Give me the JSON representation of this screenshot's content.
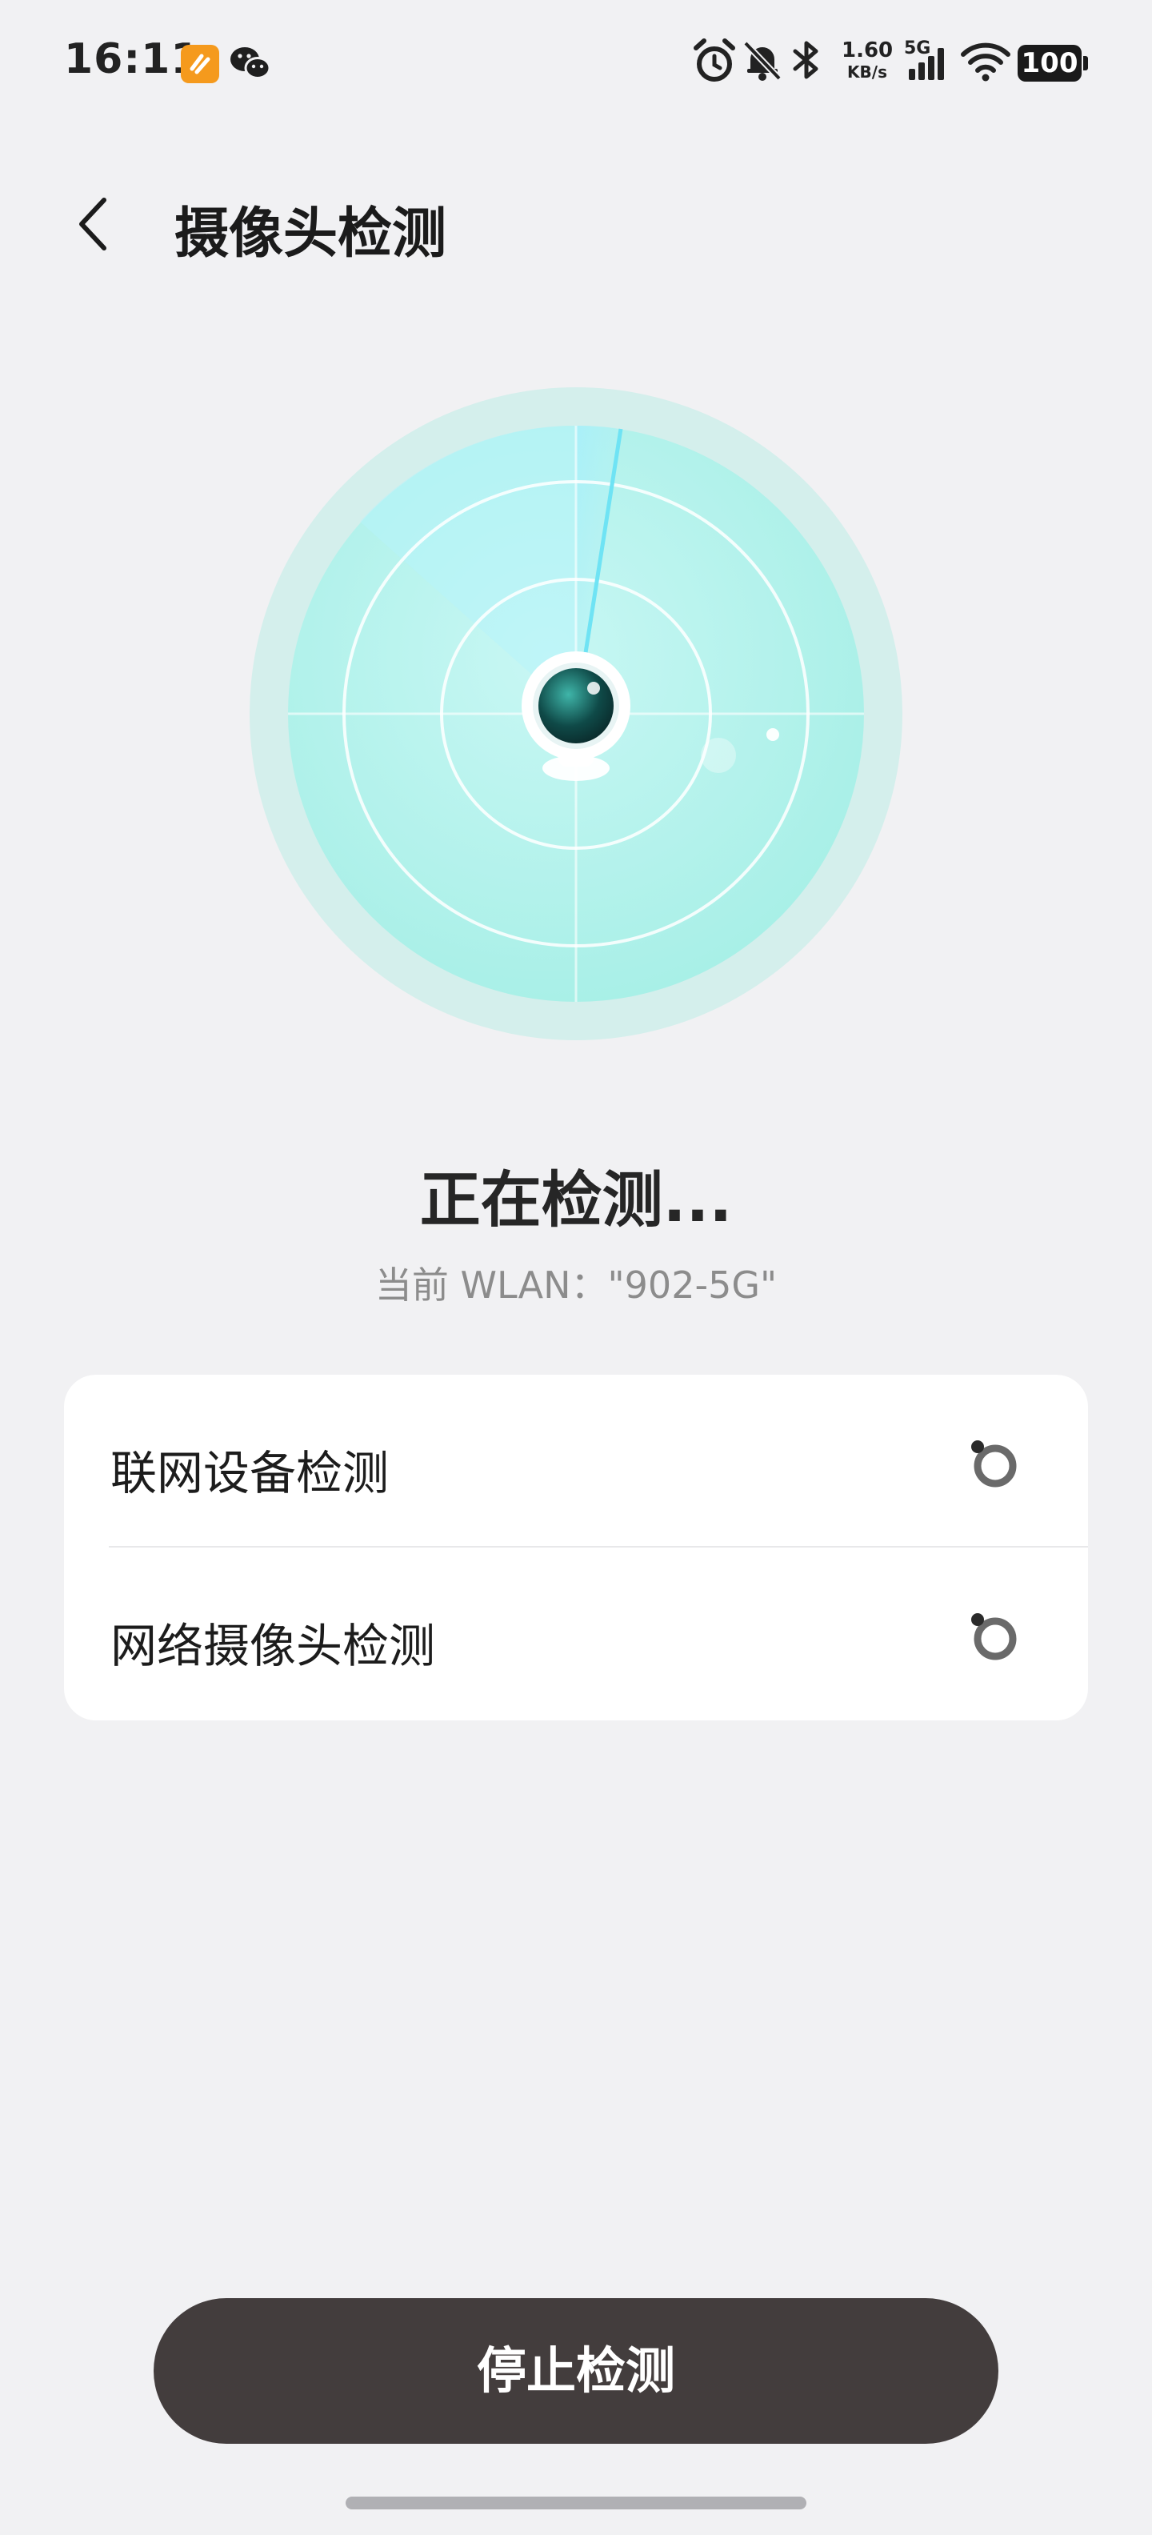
{
  "status_bar": {
    "time": "16:11",
    "speed_value": "1.60",
    "speed_unit": "KB/s",
    "network_type": "5G",
    "battery": "100",
    "icons": [
      "app-notification-icon",
      "wechat-icon",
      "alarm-icon",
      "bell-muted-icon",
      "bluetooth-icon",
      "signal-icon",
      "wifi-icon",
      "battery-icon"
    ]
  },
  "header": {
    "back_icon": "chevron-left-icon",
    "title": "摄像头检测"
  },
  "scan": {
    "title": "正在检测...",
    "wlan_label": "当前 WLAN：\"902-5G\""
  },
  "checks": [
    {
      "label": "联网设备检测",
      "status_icon": "loading-spinner-icon"
    },
    {
      "label": "网络摄像头检测",
      "status_icon": "loading-spinner-icon"
    }
  ],
  "actions": {
    "stop_label": "停止检测"
  },
  "colors": {
    "background": "#f1f1f3",
    "radar_outer": "#d4efec",
    "radar_inner": "#a8f2ea",
    "button": "#433d3d"
  }
}
